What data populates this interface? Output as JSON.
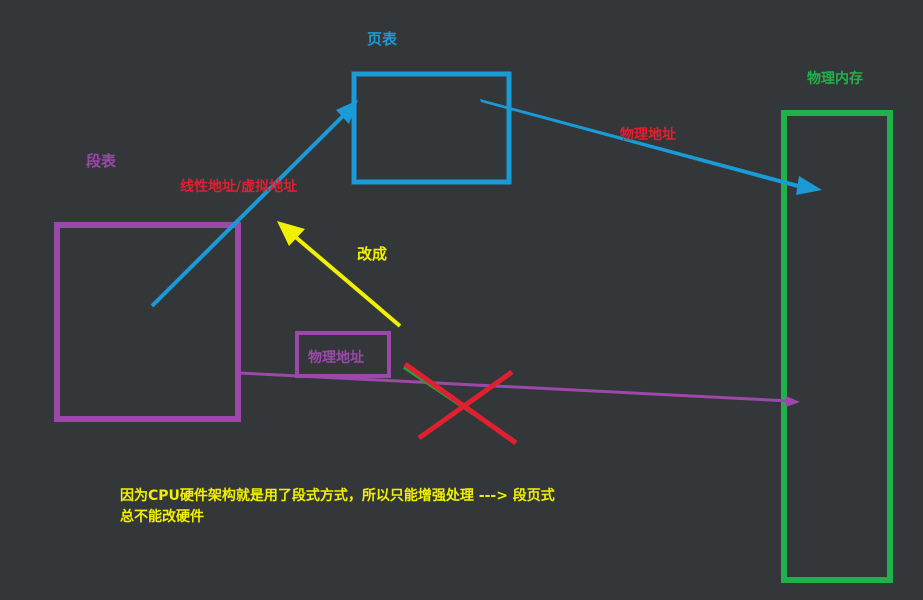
{
  "colors": {
    "background": "#33373a",
    "blue": "#1a9ad6",
    "purple": "#9b49a8",
    "green": "#1fb24a",
    "red": "#e02030",
    "yellow": "#f0f000",
    "redline_green": "#2e9a3a"
  },
  "labels": {
    "page_table": "页表",
    "physical_memory": "物理内存",
    "segment_table": "段表",
    "linear_virtual_address": "线性地址/虚拟地址",
    "physical_address_top": "物理地址",
    "change_to": "改成",
    "physical_address_box": "物理地址"
  },
  "note": {
    "line1": "因为CPU硬件架构就是用了段式方式，所以只能增强处理 ---> 段页式",
    "line2": "总不能改硬件"
  }
}
